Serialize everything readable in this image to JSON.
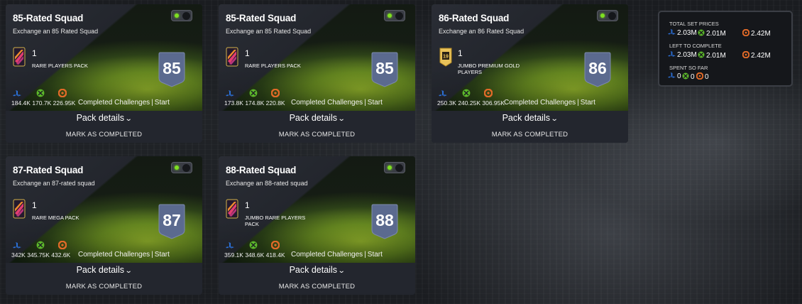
{
  "colors": {
    "accent_green": "#7ee021",
    "ps": "#2b6fd6",
    "xbox": "#5cb82a",
    "pc": "#e06a28",
    "badge": "#5b6a8f"
  },
  "cards": [
    {
      "title": "85-Rated Squad",
      "subtitle": "Exchange an 85 Rated Squad",
      "pack_count": "1",
      "pack_name": "RARE PLAYERS PACK",
      "pack_icon": "rare-pack-icon",
      "rating": "85",
      "prices": {
        "ps": "184.4K",
        "xbox": "170.7K",
        "pc": "226.95K"
      },
      "completed_label": "Completed Challenges",
      "start_label": "Start",
      "details_label": "Pack details",
      "mark_label": "MARK AS COMPLETED"
    },
    {
      "title": "85-Rated Squad",
      "subtitle": "Exchange an 85 Rated Squad",
      "pack_count": "1",
      "pack_name": "RARE PLAYERS PACK",
      "pack_icon": "rare-pack-icon",
      "rating": "85",
      "prices": {
        "ps": "173.8K",
        "xbox": "174.8K",
        "pc": "220.8K"
      },
      "completed_label": "Completed Challenges",
      "start_label": "Start",
      "details_label": "Pack details",
      "mark_label": "MARK AS COMPLETED"
    },
    {
      "title": "86-Rated Squad",
      "subtitle": "Exchange an 86 Rated Squad",
      "pack_count": "1",
      "pack_name": "JUMBO PREMIUM GOLD PLAYERS",
      "pack_icon": "gold-pack-icon",
      "pack_icon_text": "19",
      "rating": "86",
      "prices": {
        "ps": "250.3K",
        "xbox": "240.25K",
        "pc": "306.95K"
      },
      "completed_label": "Completed Challenges",
      "start_label": "Start",
      "details_label": "Pack details",
      "mark_label": "MARK AS COMPLETED"
    },
    {
      "title": "87-Rated Squad",
      "subtitle": "Exchange an 87-rated squad",
      "pack_count": "1",
      "pack_name": "RARE MEGA PACK",
      "pack_icon": "rare-pack-icon",
      "rating": "87",
      "prices": {
        "ps": "342K",
        "xbox": "345.75K",
        "pc": "432.6K"
      },
      "completed_label": "Completed Challenges",
      "start_label": "Start",
      "details_label": "Pack details",
      "mark_label": "MARK AS COMPLETED"
    },
    {
      "title": "88-Rated Squad",
      "subtitle": "Exchange an 88-rated squad",
      "pack_count": "1",
      "pack_name": "JUMBO RARE PLAYERS PACK",
      "pack_icon": "rare-pack-icon",
      "rating": "88",
      "prices": {
        "ps": "359.1K",
        "xbox": "348.6K",
        "pc": "418.4K"
      },
      "completed_label": "Completed Challenges",
      "start_label": "Start",
      "details_label": "Pack details",
      "mark_label": "MARK AS COMPLETED"
    }
  ],
  "summary": {
    "total_label": "TOTAL SET PRICES",
    "total": {
      "ps": "2.03M",
      "xbox": "2.01M",
      "pc": "2.42M"
    },
    "left_label": "LEFT TO COMPLETE",
    "left": {
      "ps": "2.03M",
      "xbox": "2.01M",
      "pc": "2.42M"
    },
    "spent_label": "SPENT SO FAR",
    "spent": {
      "ps": "0",
      "xbox": "0",
      "pc": "0"
    }
  }
}
